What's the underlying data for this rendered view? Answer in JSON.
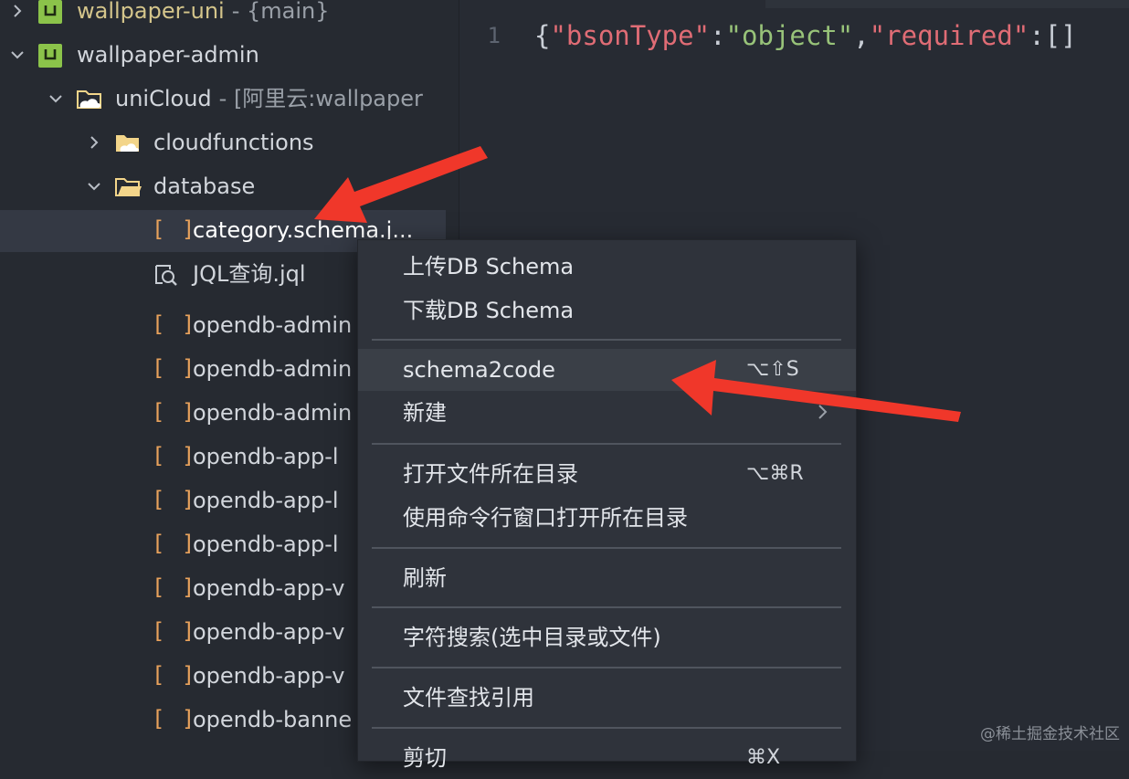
{
  "editor": {
    "line_number": "1",
    "code": {
      "open_brace": "{",
      "key1": "\"bsonType\"",
      "colon1": ":",
      "val1": "\"object\"",
      "comma1": ",",
      "key2": "\"required\"",
      "colon2": ":",
      "val2": "[]"
    }
  },
  "tree": {
    "wallpaper_uni": {
      "label": "wallpaper-uni",
      "sub": "- {main}"
    },
    "wallpaper_admin": {
      "label": "wallpaper-admin"
    },
    "unicloud": {
      "label": "uniCloud",
      "sub": "- [阿里云:wallpaper"
    },
    "cloudfunctions": {
      "label": "cloudfunctions"
    },
    "database": {
      "label": "database"
    },
    "files": [
      {
        "label": "category.schema.j..."
      },
      {
        "label": "JQL查询.jql"
      },
      {
        "label": "opendb-admin"
      },
      {
        "label": "opendb-admin"
      },
      {
        "label": "opendb-admin"
      },
      {
        "label": "opendb-app-l"
      },
      {
        "label": "opendb-app-l"
      },
      {
        "label": "opendb-app-l"
      },
      {
        "label": "opendb-app-v"
      },
      {
        "label": "opendb-app-v"
      },
      {
        "label": "opendb-app-v"
      },
      {
        "label": "opendb-banne"
      }
    ],
    "bracket_glyph": "[ ]",
    "project_icon_glyph": "U"
  },
  "context_menu": {
    "items": [
      {
        "label": "上传DB Schema",
        "shortcut": ""
      },
      {
        "label": "下载DB Schema",
        "shortcut": ""
      },
      {
        "label": "schema2code",
        "shortcut": "⌥⇧S"
      },
      {
        "label": "新建",
        "shortcut": ""
      },
      {
        "label": "打开文件所在目录",
        "shortcut": "⌥⌘R"
      },
      {
        "label": "使用命令行窗口打开所在目录",
        "shortcut": ""
      },
      {
        "label": "刷新",
        "shortcut": ""
      },
      {
        "label": "字符搜索(选中目录或文件)",
        "shortcut": ""
      },
      {
        "label": "文件查找引用",
        "shortcut": ""
      },
      {
        "label": "剪切",
        "shortcut": "⌘X"
      }
    ]
  },
  "watermark": "@稀土掘金技术社区",
  "colors": {
    "sidebar_bg": "#262a31",
    "menu_bg": "#2f333b",
    "highlight_bg": "#3a3f47",
    "project_icon": "#8bc34a",
    "folder": "#f3d58a",
    "bracket": "#e8a25c",
    "annotation_arrow": "#f0372a"
  }
}
